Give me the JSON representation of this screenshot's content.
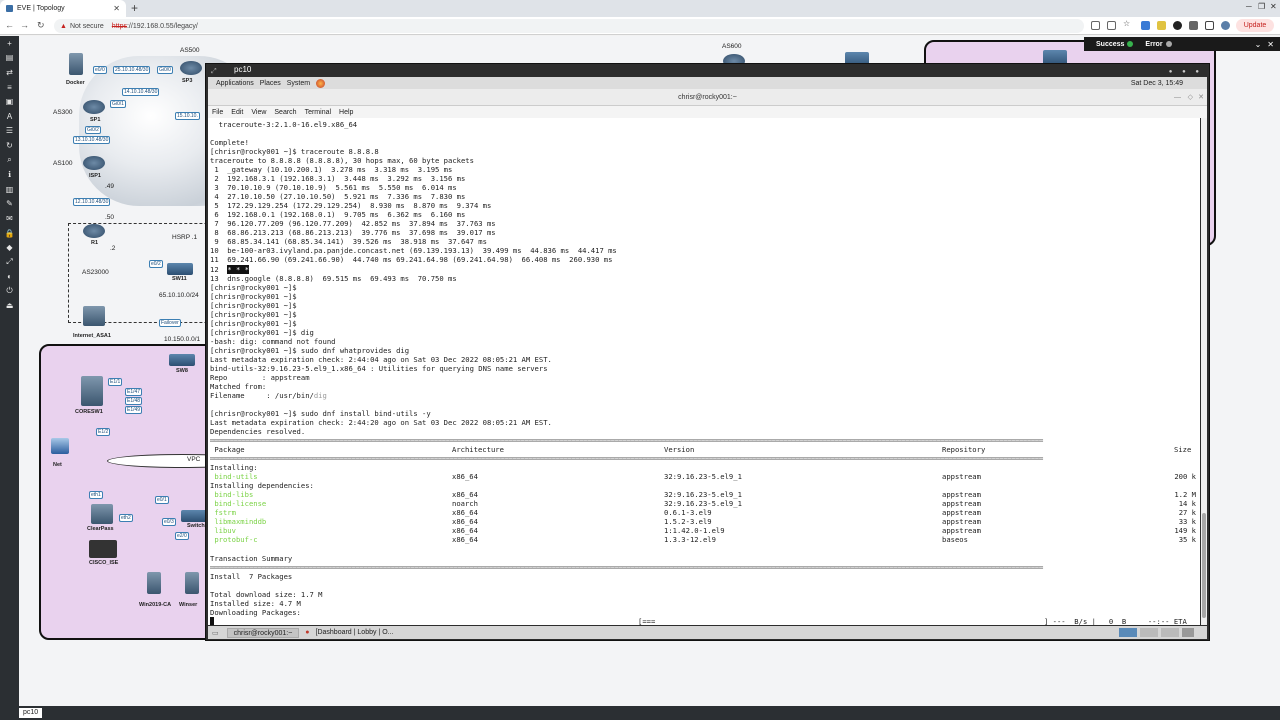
{
  "browser": {
    "tab_title": "EVE | Topology",
    "url_warning": "Not secure",
    "url_proto": "https",
    "url_rest": "://192.168.0.55/legacy/",
    "update_label": "Update"
  },
  "notifications": {
    "success": "Success",
    "error": "Error"
  },
  "topology": {
    "labels": [
      "AS500",
      "AS300",
      "AS100",
      "AS23000",
      "AS600",
      "HSRP .1",
      "VPC",
      "10.150.0.0/1",
      "65.10.10.0/24",
      ".49",
      ".50",
      ".2"
    ],
    "nodes": [
      "Docker",
      "SP3",
      "SP1",
      "ISP1",
      "R1",
      "SW11",
      "Internet_ASA1",
      "SW8",
      "CORESW1",
      "Net",
      "ClearPass",
      "CISCO_ISE",
      "Win2019-CA",
      "Winser",
      "Switch"
    ],
    "links": [
      "e0/0",
      "25.10.10.48/30",
      "Gi0/0",
      "14.10.10.48/30",
      "Gi0/1",
      "15.10.10.",
      "13.10.10.48/30",
      "Gi0/2",
      "12.10.10.48/30",
      "Failover",
      "E1/1",
      "E1/47",
      "E1/48",
      "E1/49",
      "E1/2",
      "e0/2",
      "e0/3",
      "e0/1",
      "eth1",
      "eth2",
      "e2/0"
    ]
  },
  "vnc": {
    "window_title": "pc10",
    "gnome_menu": [
      "Applications",
      "Places",
      "System"
    ],
    "clock": "Sat Dec 3, 15:49",
    "terminal_title": "chrisr@rocky001:~",
    "terminal_menu": [
      "File",
      "Edit",
      "View",
      "Search",
      "Terminal",
      "Help"
    ],
    "lines": [
      "  traceroute-3:2.1.0-16.el9.x86_64",
      "",
      "Complete!",
      "[chrisr@rocky001 ~]$ traceroute 8.8.8.8",
      "traceroute to 8.8.8.8 (8.8.8.8), 30 hops max, 60 byte packets",
      " 1  _gateway (10.10.200.1)  3.278 ms  3.318 ms  3.195 ms",
      " 2  192.168.3.1 (192.168.3.1)  3.448 ms  3.292 ms  3.156 ms",
      " 3  70.10.10.9 (70.10.10.9)  5.561 ms  5.550 ms  6.014 ms",
      " 4  27.10.10.50 (27.10.10.50)  5.921 ms  7.336 ms  7.830 ms",
      " 5  172.29.129.254 (172.29.129.254)  8.930 ms  8.870 ms  9.374 ms",
      " 6  192.168.0.1 (192.168.0.1)  9.705 ms  6.362 ms  6.160 ms",
      " 7  96.120.77.209 (96.120.77.209)  42.852 ms  37.894 ms  37.763 ms",
      " 8  68.86.213.213 (68.86.213.213)  39.776 ms  37.698 ms  39.017 ms",
      " 9  68.85.34.141 (68.85.34.141)  39.526 ms  38.918 ms  37.647 ms",
      "10  be-100-ar03.ivyland.pa.panjde.concast.net (69.139.193.13)  39.499 ms  44.836 ms  44.417 ms",
      "11  69.241.66.90 (69.241.66.90)  44.740 ms 69.241.64.98 (69.241.64.98)  66.408 ms  260.930 ms"
    ],
    "line12_num": "12  ",
    "line12_hl": "* * *",
    "lines_b": [
      "13  dns.google (8.8.8.8)  69.515 ms  69.493 ms  70.750 ms",
      "[chrisr@rocky001 ~]$",
      "[chrisr@rocky001 ~]$",
      "[chrisr@rocky001 ~]$",
      "[chrisr@rocky001 ~]$",
      "[chrisr@rocky001 ~]$",
      "[chrisr@rocky001 ~]$ dig",
      "-bash: dig: command not found",
      "[chrisr@rocky001 ~]$ sudo dnf whatprovides dig",
      "Last metadata expiration check: 2:44:04 ago on Sat 03 Dec 2022 08:05:21 AM EST.",
      "bind-utils-32:9.16.23-5.el9_1.x86_64 : Utilities for querying DNS name servers",
      "Repo        : appstream",
      "Matched from:"
    ],
    "filename_label": "Filename     : /usr/bin/",
    "filename_hl": "dig",
    "lines_c": [
      "",
      "[chrisr@rocky001 ~]$ sudo dnf install bind-utils -y",
      "Last metadata expiration check: 2:44:20 ago on Sat 03 Dec 2022 08:05:21 AM EST.",
      "Dependencies resolved."
    ],
    "table_headers": {
      "package": " Package",
      "arch": "Architecture",
      "version": "Version",
      "repo": "Repository",
      "size": "Size"
    },
    "installing_label": "Installing:",
    "installing": [
      {
        "name": " bind-utils",
        "arch": "x86_64",
        "version": "32:9.16.23-5.el9_1",
        "repo": "appstream",
        "size": "200 k"
      }
    ],
    "deps_label": "Installing dependencies:",
    "deps": [
      {
        "name": " bind-libs",
        "arch": "x86_64",
        "version": "32:9.16.23-5.el9_1",
        "repo": "appstream",
        "size": "1.2 M"
      },
      {
        "name": " bind-license",
        "arch": "noarch",
        "version": "32:9.16.23-5.el9_1",
        "repo": "appstream",
        "size": "14 k"
      },
      {
        "name": " fstrm",
        "arch": "x86_64",
        "version": "0.6.1-3.el9",
        "repo": "appstream",
        "size": "27 k"
      },
      {
        "name": " libmaxminddb",
        "arch": "x86_64",
        "version": "1.5.2-3.el9",
        "repo": "appstream",
        "size": "33 k"
      },
      {
        "name": " libuv",
        "arch": "x86_64",
        "version": "1:1.42.0-1.el9",
        "repo": "appstream",
        "size": "149 k"
      },
      {
        "name": " protobuf-c",
        "arch": "x86_64",
        "version": "1.3.3-12.el9",
        "repo": "baseos",
        "size": "35 k"
      }
    ],
    "summary_label": "Transaction Summary",
    "install_count": "Install  7 Packages",
    "total_size": "Total download size: 1.7 M",
    "installed_size": "Installed size: 4.7 M",
    "downloading": "Downloading Packages:",
    "progress_bar": "[===",
    "progress_stats": "] ---  B/s |   0  B     --:-- ETA",
    "taskbar_items": [
      "chrisr@rocky001:~",
      "[Dashboard | Lobby | O..."
    ]
  },
  "bottom_tab": "pc10"
}
